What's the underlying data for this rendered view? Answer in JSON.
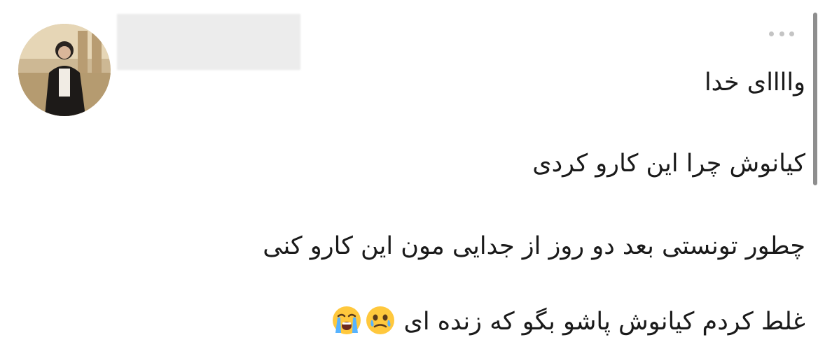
{
  "post": {
    "lines": [
      "واااای خدا",
      "کیانوش چرا این کارو کردی",
      "چطور تونستی بعد دو روز از جدایی مون این کارو کنی",
      "غلط کردم کیانوش پاشو بگو که زنده ای"
    ],
    "emojis": [
      "face-holding-back-tears-icon",
      "loudly-crying-face-icon"
    ]
  },
  "colors": {
    "text": "#1a1a1a",
    "scrollbar": "#8e8e8e",
    "more_dots": "#c4c4c4",
    "redacted_name": "#ececec"
  }
}
